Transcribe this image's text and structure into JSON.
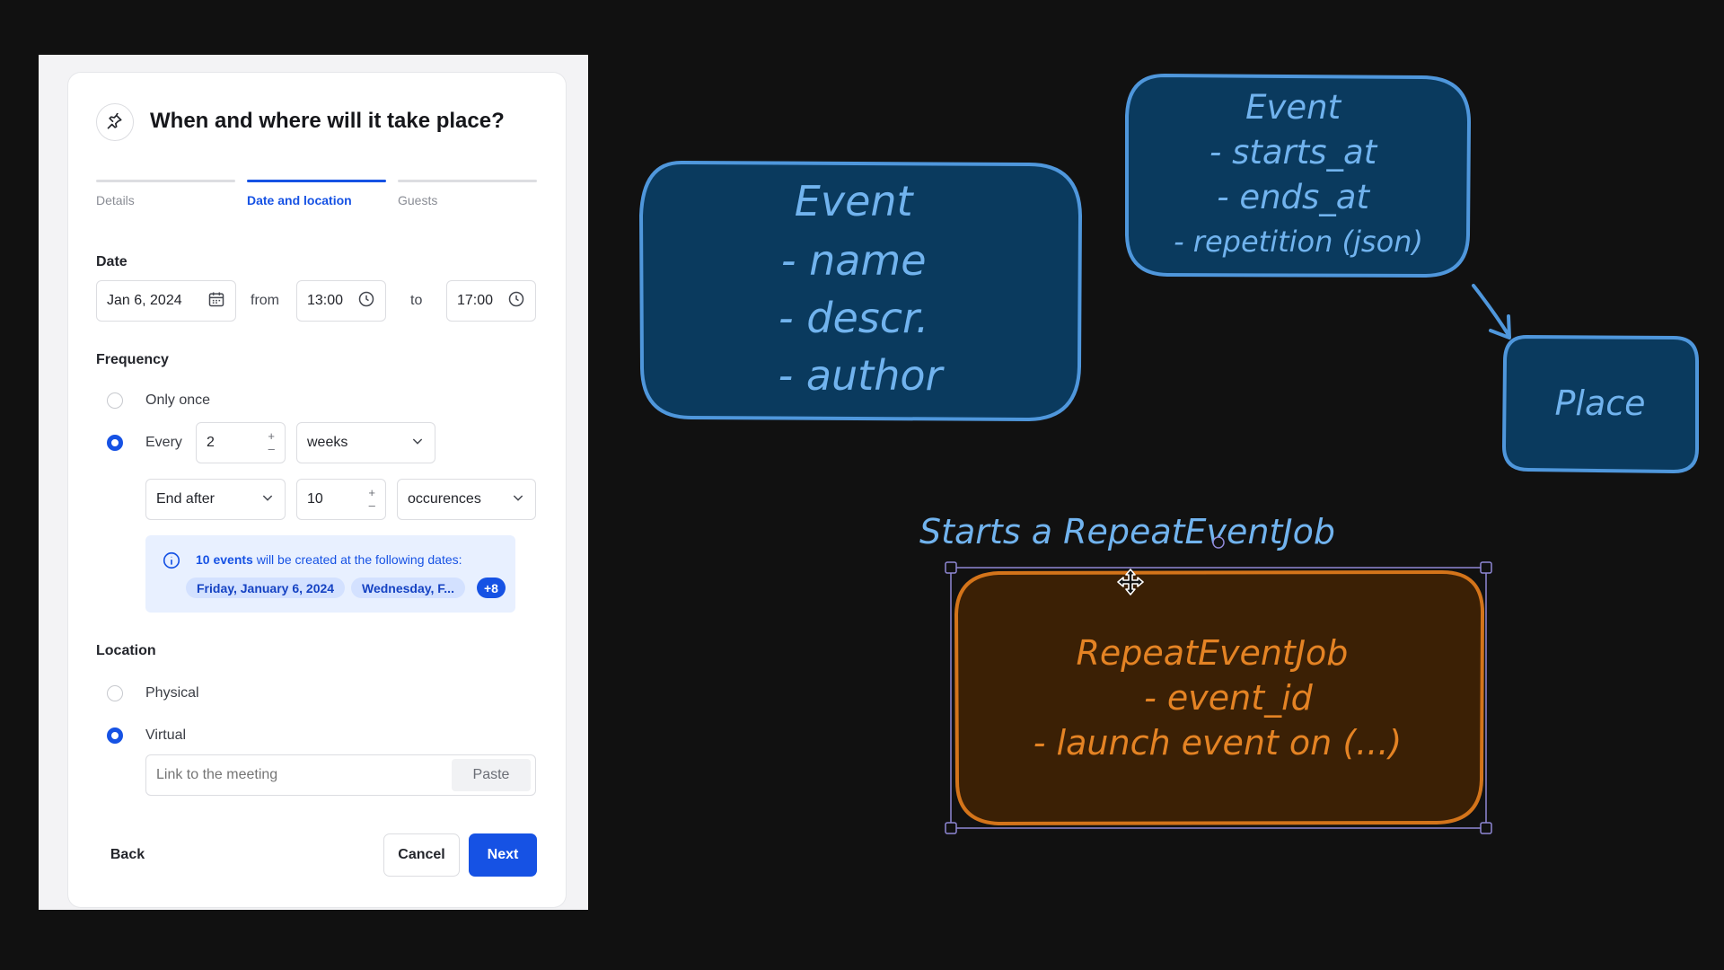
{
  "form": {
    "title": "When and where will it take place?",
    "steps": [
      {
        "label": "Details",
        "active": false
      },
      {
        "label": "Date and location",
        "active": true
      },
      {
        "label": "Guests",
        "active": false
      }
    ],
    "date": {
      "section_label": "Date",
      "date_value": "Jan 6, 2024",
      "from_label": "from",
      "start_time": "13:00",
      "to_label": "to",
      "end_time": "17:00"
    },
    "frequency": {
      "section_label": "Frequency",
      "only_once_label": "Only once",
      "every_label": "Every",
      "interval_value": "2",
      "interval_unit": "weeks",
      "end_mode": "End after",
      "end_count": "10",
      "end_unit": "occurences",
      "selected": "every"
    },
    "info": {
      "count_text": "10 events",
      "rest_text": " will be created at the following dates:",
      "chips": [
        "Friday, January 6, 2024",
        "Wednesday, F..."
      ],
      "more": "+8"
    },
    "location": {
      "section_label": "Location",
      "physical_label": "Physical",
      "virtual_label": "Virtual",
      "selected": "virtual",
      "link_placeholder": "Link to the meeting",
      "paste_label": "Paste"
    },
    "footer": {
      "back_label": "Back",
      "cancel_label": "Cancel",
      "next_label": "Next"
    }
  },
  "whiteboard": {
    "event_box": [
      "Event",
      "- name",
      "- descr.",
      "- author"
    ],
    "event_time_box": [
      "Event",
      "- starts_at",
      "- ends_at",
      "- repetition (json)"
    ],
    "place_box": "Place",
    "starts_label": "Starts a RepeatEventJob",
    "job_box": [
      "RepeatEventJob",
      "- event_id",
      "- launch event on (...)"
    ]
  },
  "colors": {
    "primary": "#1652e4",
    "board_blue_fill": "#0a3a5e",
    "board_blue_stroke": "#4f97dc",
    "board_blue_text": "#71b3ee",
    "board_orange_fill": "#3b2005",
    "board_orange_stroke": "#d4741a",
    "board_orange_text": "#e48324",
    "selection": "#8f88d6"
  }
}
